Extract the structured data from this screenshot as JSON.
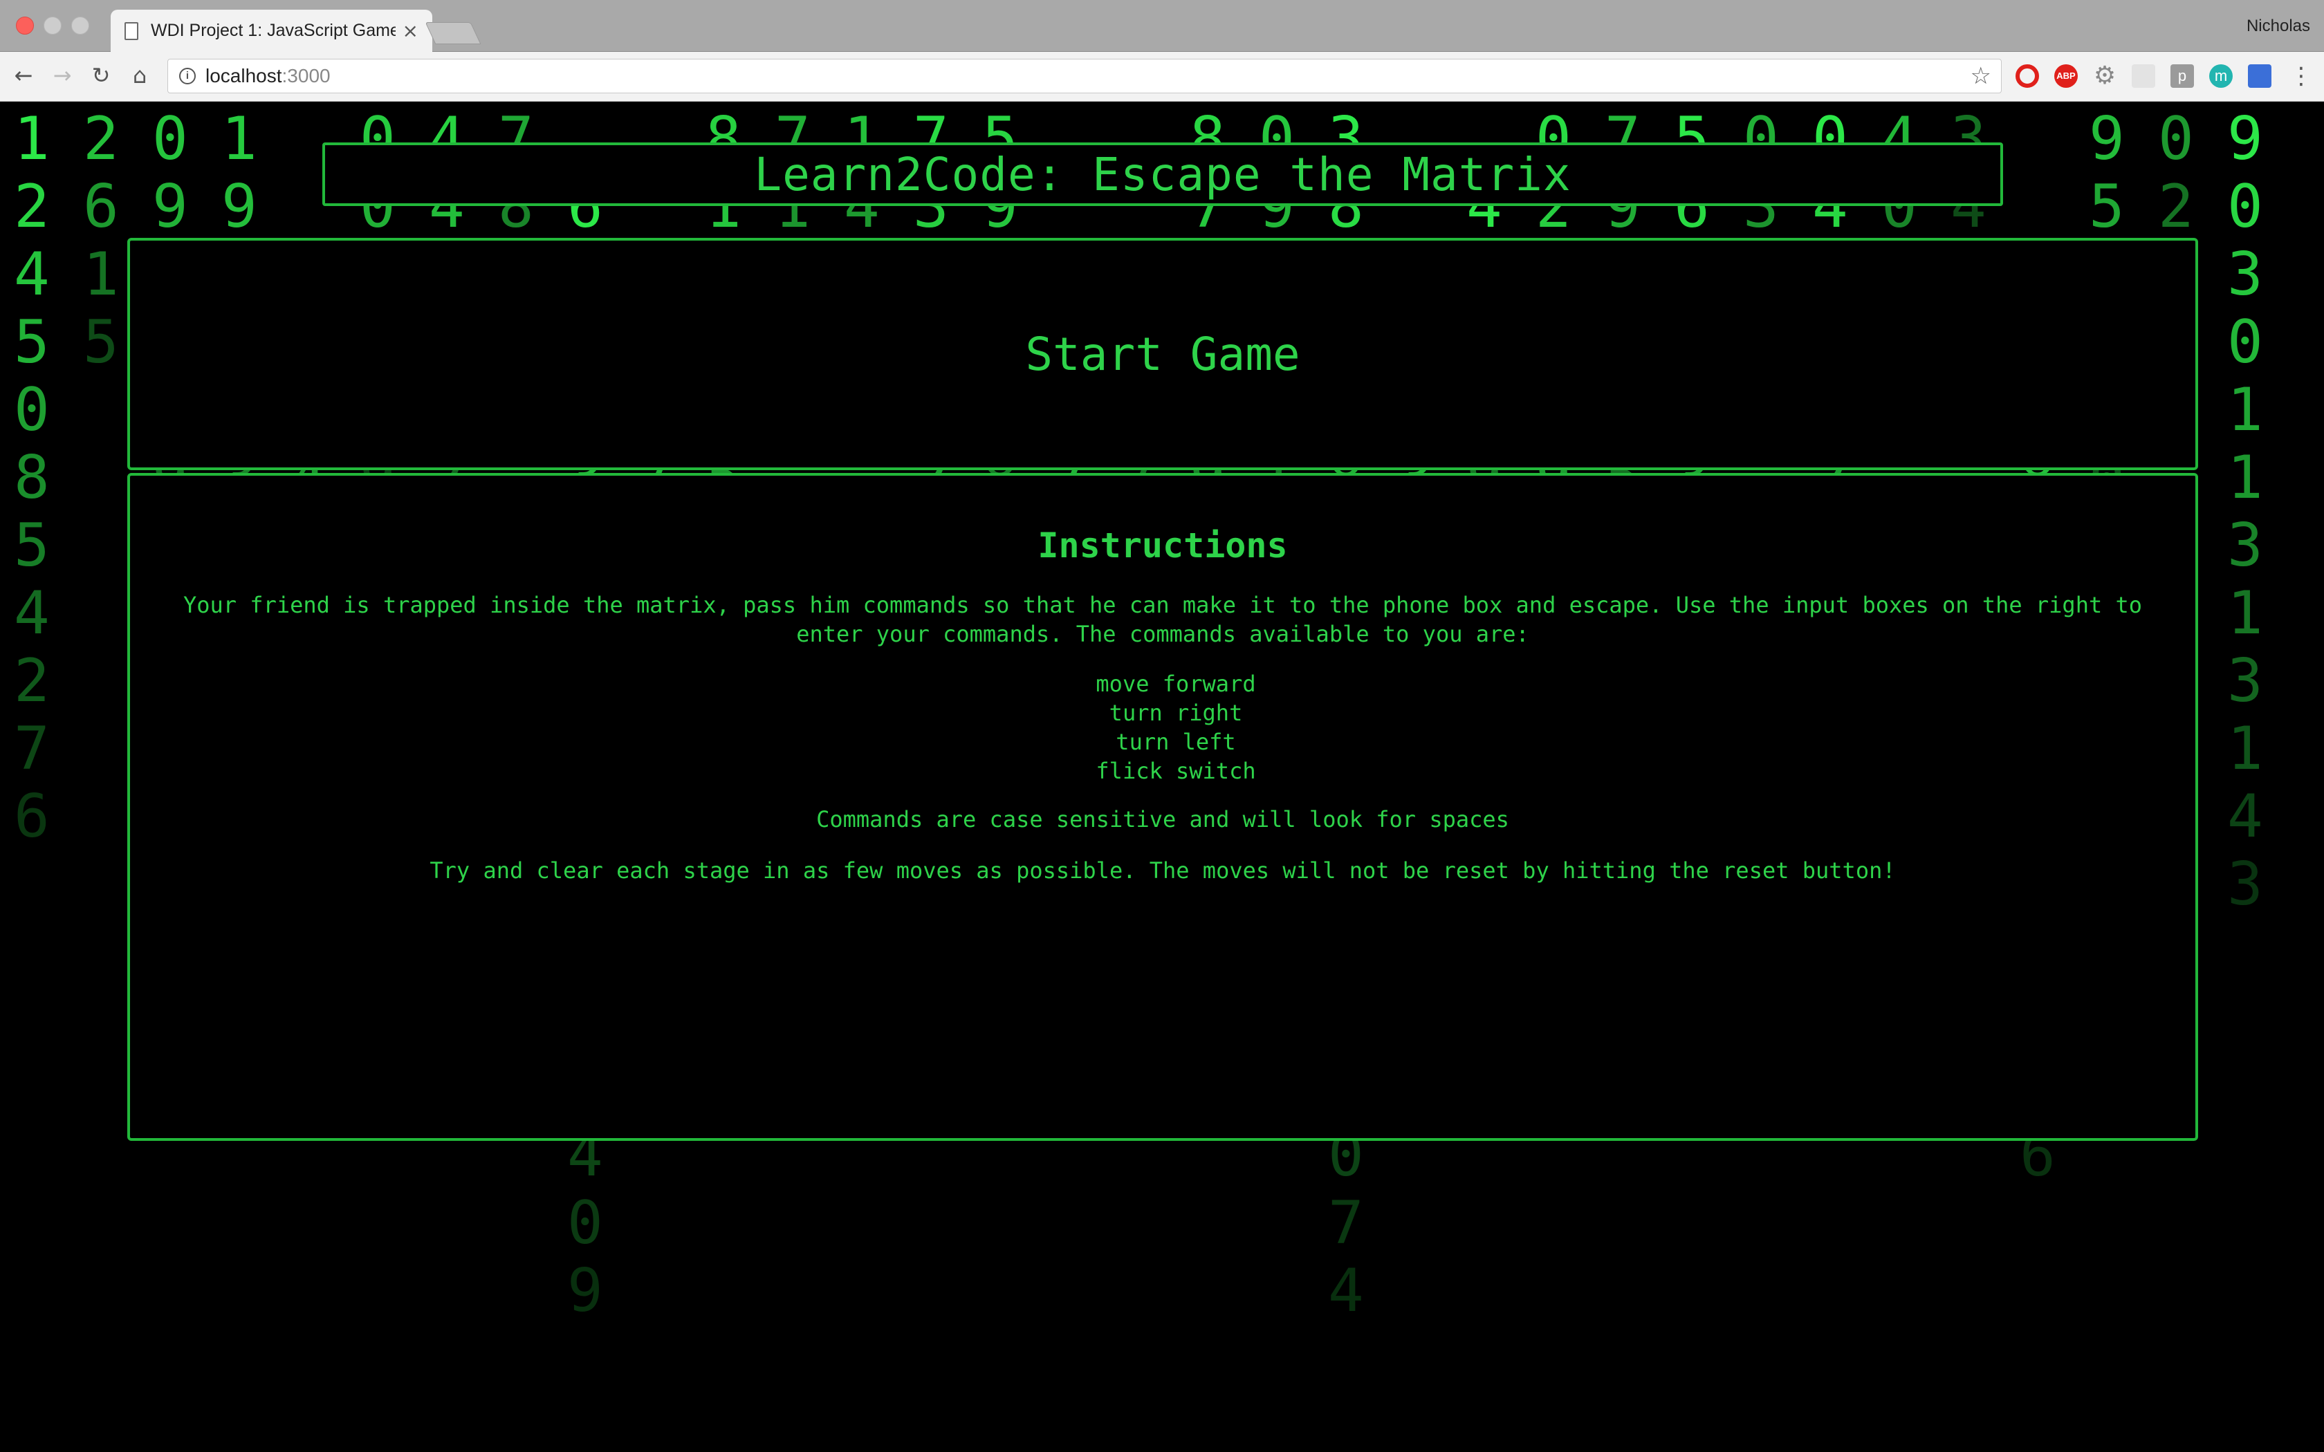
{
  "browser": {
    "tab_title": "WDI Project 1: JavaScript Game",
    "tab_close": "×",
    "profile_name": "Nicholas",
    "url_host": "localhost",
    "url_port": ":3000",
    "extensions": [
      "opera-icon",
      "adblock-plus-icon",
      "gear-icon",
      "blank-extension-icon",
      "p-extension-icon",
      "m-extension-icon",
      "calendar-extension-icon"
    ],
    "ext_abp_label": "ABP",
    "ext_p_label": "p",
    "ext_m_label": "m"
  },
  "page": {
    "title": "Learn2Code: Escape the Matrix",
    "start_button": "Start Game",
    "instructions": {
      "heading": "Instructions",
      "intro": "Your friend is trapped inside the matrix, pass him commands so that he can make it to the phone box and escape. Use the input boxes on the right to enter your commands. The commands available to you are:",
      "commands": [
        "move forward",
        "turn right",
        "turn left",
        "flick switch"
      ],
      "case_note": "Commands are case sensitive and will look for spaces",
      "moves_note": "Try and clear each stage in as few moves as possible. The moves will not be reset by hitting the reset button!"
    }
  },
  "colors": {
    "matrix_green": "#2ed34a",
    "border_green": "#22b83a",
    "background": "#000000"
  }
}
